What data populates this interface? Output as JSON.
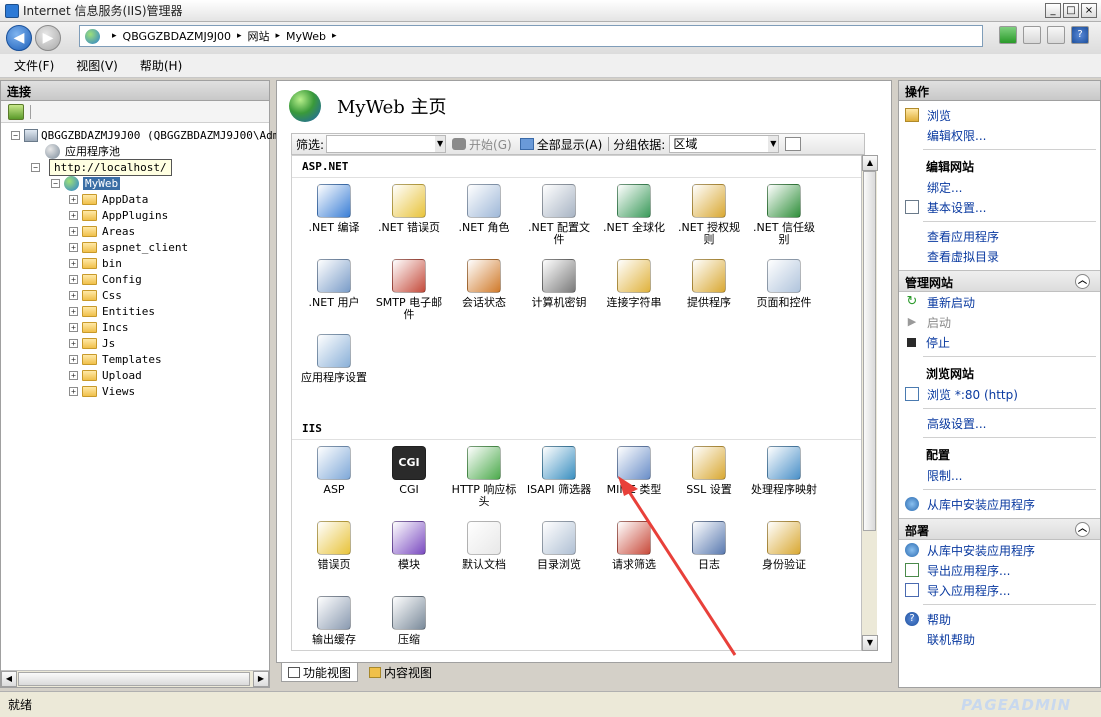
{
  "window": {
    "title": "Internet 信息服务(IIS)管理器",
    "controls": {
      "minimize": "_",
      "maximize": "□",
      "close": "×"
    }
  },
  "address": {
    "breadcrumb": [
      "QBGGZBDAZMJ9J00",
      "网站",
      "MyWeb"
    ],
    "separator": "▸"
  },
  "menu": {
    "items": [
      "文件(F)",
      "视图(V)",
      "帮助(H)"
    ]
  },
  "connections": {
    "title": "连接",
    "server": "QBGGZBDAZMJ9J00 (QBGGZBDAZMJ9J00\\Admi",
    "app_pool": "应用程序池",
    "tooltip": "http://localhost/",
    "site": "MyWeb",
    "folders": [
      "AppData",
      "AppPlugins",
      "Areas",
      "aspnet_client",
      "bin",
      "Config",
      "Css",
      "Entities",
      "Incs",
      "Js",
      "Templates",
      "Upload",
      "Views"
    ]
  },
  "center": {
    "page_title": "MyWeb 主页",
    "filter": {
      "label": "筛选:",
      "start": "开始(G)",
      "show_all": "全部显示(A)",
      "group_label": "分组依据:",
      "group_value": "区域"
    },
    "sections": [
      {
        "title": "ASP.NET",
        "features": [
          {
            "label": ".NET 编译",
            "icon": "download-arrow-icon",
            "color": "#3b7fd6"
          },
          {
            "label": ".NET 错误页",
            "icon": "warning-404-icon",
            "color": "#e8c33a"
          },
          {
            "label": ".NET 角色",
            "icon": "documents-icon",
            "color": "#9fb8d8"
          },
          {
            "label": ".NET 配置文件",
            "icon": "config-file-icon",
            "color": "#a8b4c4"
          },
          {
            "label": ".NET 全球化",
            "icon": "globe-icon",
            "color": "#3a9a5a"
          },
          {
            "label": ".NET 授权规则",
            "icon": "lock-document-icon",
            "color": "#d9a832"
          },
          {
            "label": ".NET 信任级别",
            "icon": "globe-check-icon",
            "color": "#2f8f3a"
          },
          {
            "label": ".NET 用户",
            "icon": "user-icon",
            "color": "#7a9cc8"
          },
          {
            "label": "SMTP 电子邮件",
            "icon": "email-icon",
            "color": "#c44a3a"
          },
          {
            "label": "会话状态",
            "icon": "session-user-icon",
            "color": "#d07a2a"
          },
          {
            "label": "计算机密钥",
            "icon": "server-key-icon",
            "color": "#7a7a7a"
          },
          {
            "label": "连接字符串",
            "icon": "database-icon",
            "color": "#e0b23c"
          },
          {
            "label": "提供程序",
            "icon": "provider-user-icon",
            "color": "#d9a832"
          },
          {
            "label": "页面和控件",
            "icon": "page-controls-icon",
            "color": "#b0c4dc"
          },
          {
            "label": "应用程序设置",
            "icon": "settings-list-icon",
            "color": "#8ab0d8"
          }
        ]
      },
      {
        "title": "IIS",
        "features": [
          {
            "label": "ASP",
            "icon": "asp-gear-icon",
            "color": "#7fa8d8"
          },
          {
            "label": "CGI",
            "icon": "cgi-icon",
            "color": "#2a2a2a",
            "badge": "CGI"
          },
          {
            "label": "HTTP 响应标头",
            "icon": "http-headers-icon",
            "color": "#4caa4c"
          },
          {
            "label": "ISAPI 筛选器",
            "icon": "filter-funnel-icon",
            "color": "#3a8fc0"
          },
          {
            "label": "MIME 类型",
            "icon": "mime-media-icon",
            "color": "#6a8ec8"
          },
          {
            "label": "SSL 设置",
            "icon": "padlock-icon",
            "color": "#d9a832"
          },
          {
            "label": "处理程序映射",
            "icon": "handler-arrows-icon",
            "color": "#4a90c8"
          },
          {
            "label": "错误页",
            "icon": "error-page-icon",
            "color": "#e8c33a"
          },
          {
            "label": "模块",
            "icon": "modules-icon",
            "color": "#7a4ac0"
          },
          {
            "label": "默认文档",
            "icon": "default-document-icon",
            "color": "#e8e8e8"
          },
          {
            "label": "目录浏览",
            "icon": "directory-browse-icon",
            "color": "#b0c0d4"
          },
          {
            "label": "请求筛选",
            "icon": "request-filter-icon",
            "color": "#c84a3a"
          },
          {
            "label": "日志",
            "icon": "log-book-icon",
            "color": "#5a7ab0"
          },
          {
            "label": "身份验证",
            "icon": "auth-user-icon",
            "color": "#d9a832"
          },
          {
            "label": "输出缓存",
            "icon": "output-cache-icon",
            "color": "#8a9ab0"
          },
          {
            "label": "压缩",
            "icon": "compression-clamp-icon",
            "color": "#7a8a9a"
          }
        ]
      }
    ],
    "view_tabs": [
      "功能视图",
      "内容视图"
    ]
  },
  "actions": {
    "title": "操作",
    "browse": "浏览",
    "edit_permissions": "编辑权限...",
    "edit_site_title": "编辑网站",
    "bindings": "绑定...",
    "basic_settings": "基本设置...",
    "view_apps": "查看应用程序",
    "view_vdirs": "查看虚拟目录",
    "manage_site": {
      "title": "管理网站",
      "restart": "重新启动",
      "start": "启动",
      "stop": "停止",
      "browse_site_title": "浏览网站",
      "browse_port": "浏览 *:80 (http)",
      "advanced": "高级设置...",
      "config_title": "配置",
      "limits": "限制...",
      "install_gallery": "从库中安装应用程序"
    },
    "deploy": {
      "title": "部署",
      "install_gallery": "从库中安装应用程序",
      "export": "导出应用程序...",
      "import": "导入应用程序..."
    },
    "help": "帮助",
    "online_help": "联机帮助"
  },
  "status": {
    "text": "就绪",
    "watermark": "PAGEADMIN"
  },
  "colors": {
    "link": "#0a3aa0",
    "annotation_arrow": "#e8403a"
  }
}
